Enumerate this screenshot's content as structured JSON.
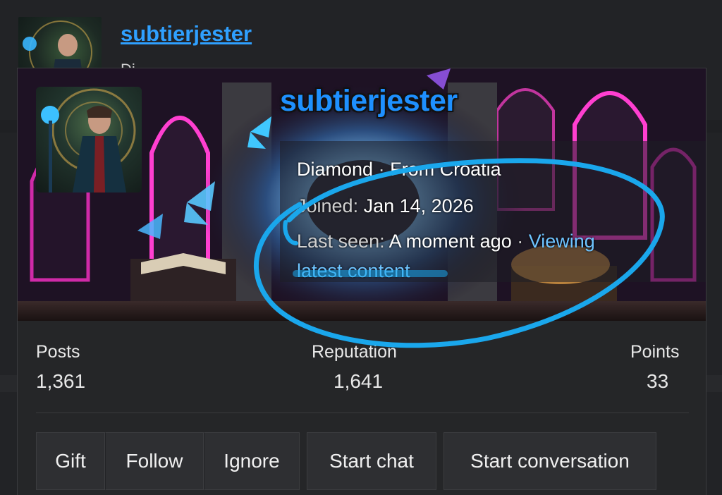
{
  "background": {
    "username": "subtierjester",
    "subtext": "Di"
  },
  "card": {
    "username": "subtierjester",
    "rank": "Diamond",
    "separator": "·",
    "location": "From Croatia",
    "joined_label": "Joined:",
    "joined_value": "Jan 14, 2026",
    "last_seen_label": "Last seen:",
    "last_seen_value": "A moment ago",
    "activity_part1": "Viewing",
    "activity_part2": "latest content"
  },
  "stats": [
    {
      "label": "Posts",
      "value": "1,361"
    },
    {
      "label": "Reputation",
      "value": "1,641"
    },
    {
      "label": "Points",
      "value": "33"
    }
  ],
  "buttons": {
    "gift": "Gift",
    "follow": "Follow",
    "ignore": "Ignore",
    "start_chat": "Start chat",
    "start_conversation": "Start conversation"
  },
  "colors": {
    "accent": "#1e90ff",
    "link": "#6ec4ff",
    "annotation": "#1aa7ec",
    "background": "#222326"
  }
}
